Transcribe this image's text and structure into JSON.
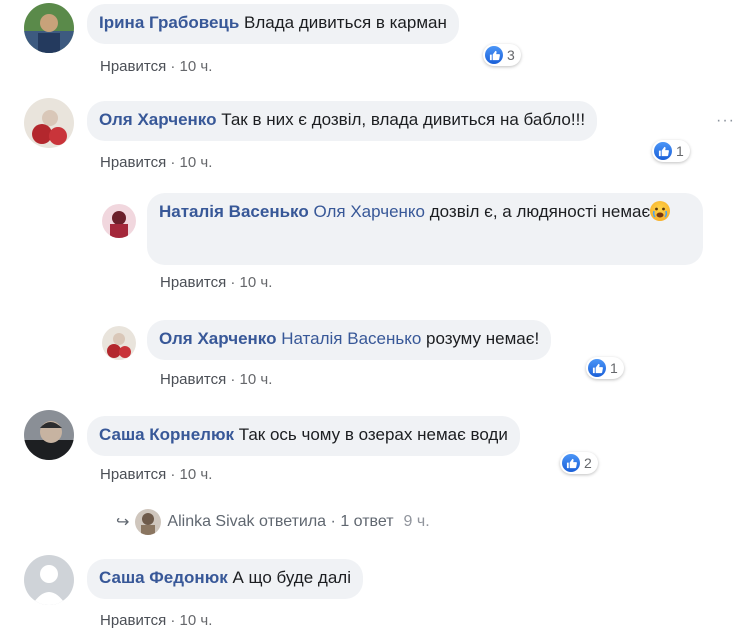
{
  "colors": {
    "author": "#385898",
    "bubble_bg": "#f0f2f5",
    "meta": "#65676b",
    "like_blue": "#1877f2"
  },
  "comments": [
    {
      "author": "Ірина Грабовець",
      "text": "Влада дивиться в карман",
      "like_label": "Нравится",
      "separator": "·",
      "time": "10 ч.",
      "reactions": "3"
    },
    {
      "author": "Оля Харченко",
      "text": "Так в них є дозвіл, влада дивиться на бабло!!!",
      "like_label": "Нравится",
      "separator": "·",
      "time": "10 ч.",
      "reactions": "1",
      "more_icon": "more-dots-icon",
      "replies": [
        {
          "author": "Наталія Васенько",
          "mention": "Оля Харченко",
          "text": "дозвіл є, а людяності немає",
          "emoji": "crying-face-emoji",
          "like_label": "Нравится",
          "separator": "·",
          "time": "10 ч."
        },
        {
          "author": "Оля Харченко",
          "mention": "Наталія Васенько",
          "text": "розуму немає!",
          "like_label": "Нравится",
          "separator": "·",
          "time": "10 ч.",
          "reactions": "1"
        }
      ]
    },
    {
      "author": "Саша Корнелюк",
      "text": "Так ось чому в озерах немає води",
      "like_label": "Нравится",
      "separator": "·",
      "time": "10 ч.",
      "reactions": "2",
      "reply_link": {
        "name": "Alinka Sivak",
        "action": "ответила",
        "separator": "·",
        "count": "1 ответ",
        "time": "9 ч."
      }
    },
    {
      "author": "Саша Федонюк",
      "text": "А що буде далі",
      "like_label": "Нравится",
      "separator": "·",
      "time": "10 ч."
    }
  ]
}
